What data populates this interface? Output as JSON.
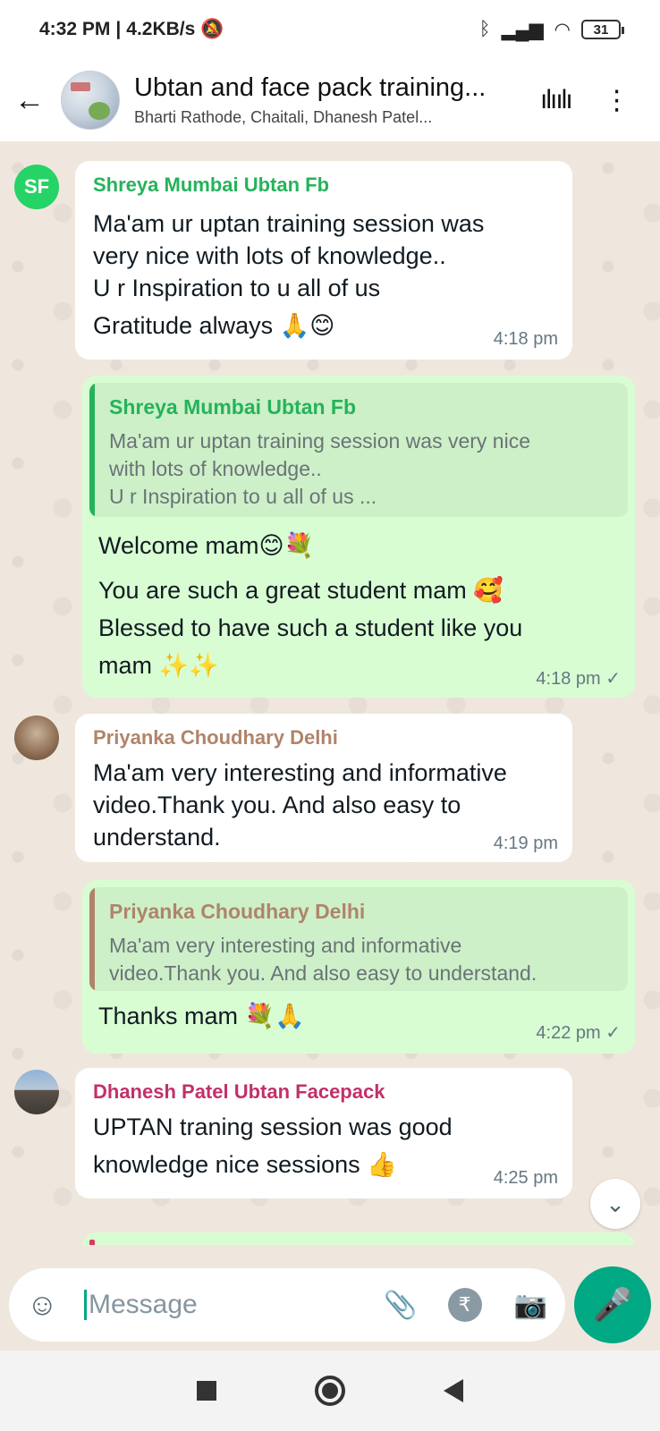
{
  "status_bar": {
    "time": "4:32 PM",
    "speed": "4.2KB/s",
    "battery": "31"
  },
  "header": {
    "title": "Ubtan and face pack training...",
    "subtitle": "Bharti Rathode, Chaitali, Dhanesh Patel..."
  },
  "messages": [
    {
      "type": "incoming",
      "avatar_initials": "SF",
      "sender": "Shreya Mumbai Ubtan Fb",
      "sender_color": "#25b35a",
      "lines": [
        "Ma'am ur uptan training session was",
        "very nice with lots of knowledge..",
        "U r Inspiration to u all of us",
        "Gratitude always 🙏😊"
      ],
      "time": "4:18 pm"
    },
    {
      "type": "outgoing",
      "quote_sender": "Shreya Mumbai Ubtan Fb",
      "quote_color": "#25b35a",
      "quote_lines": [
        "Ma'am ur uptan training session was very nice",
        "with lots of knowledge..",
        "U r Inspiration to u all of us ..."
      ],
      "lines": [
        "Welcome mam😊💐",
        "You are such a great student mam 🥰",
        "Blessed to have such a student like you",
        "mam ✨✨"
      ],
      "time": "4:18 pm ✓"
    },
    {
      "type": "incoming",
      "sender": "Priyanka Choudhary Delhi",
      "sender_color": "#b0846a",
      "lines": [
        "Ma'am very interesting and informative",
        "video.Thank you. And also easy to",
        "understand."
      ],
      "time": "4:19 pm"
    },
    {
      "type": "outgoing",
      "quote_sender": "Priyanka Choudhary Delhi",
      "quote_color": "#b0846a",
      "quote_lines": [
        "Ma'am very interesting and informative",
        "video.Thank you. And also easy to understand."
      ],
      "lines": [
        "Thanks mam 💐🙏"
      ],
      "time": "4:22 pm ✓"
    },
    {
      "type": "incoming",
      "sender": "Dhanesh Patel Ubtan Facepack",
      "sender_color": "#c2306a",
      "lines": [
        "UPTAN traning session was good",
        "knowledge nice sessions 👍"
      ],
      "time": "4:25 pm"
    }
  ],
  "input": {
    "placeholder": "Message"
  },
  "icons": {
    "back": "back-arrow-icon",
    "voice": "voice-call-icon",
    "menu": "more-options-icon",
    "emoji": "emoji-icon",
    "attach": "paperclip-icon",
    "rupee": "rupee-payment-icon",
    "camera": "camera-icon",
    "mic": "microphone-icon",
    "scroll": "double-chevron-down-icon"
  },
  "colors": {
    "accent": "#00a884",
    "outgoing_bubble": "#d9fdd3",
    "chat_background": "#efe7dd"
  }
}
